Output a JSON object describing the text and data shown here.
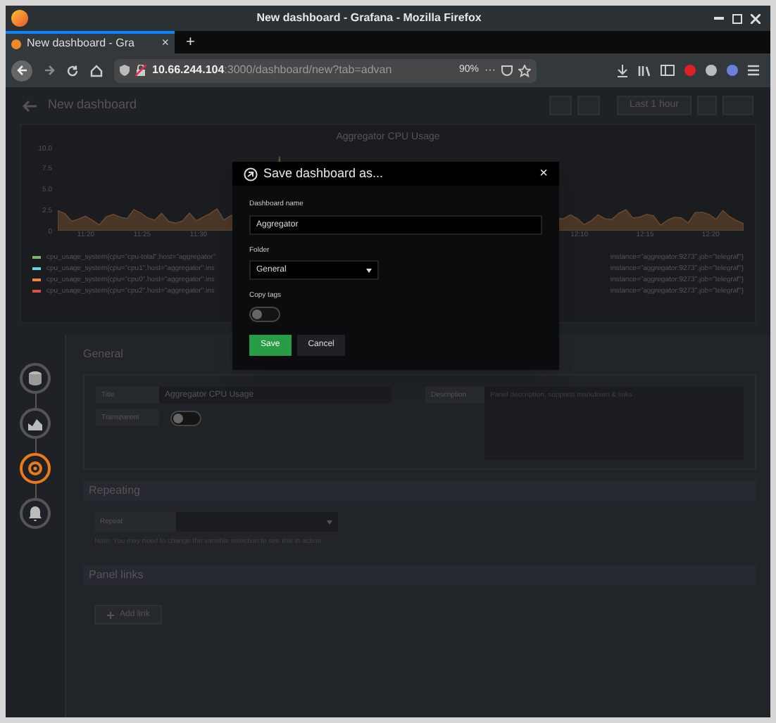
{
  "window": {
    "title": "New dashboard - Grafana - Mozilla Firefox"
  },
  "browser": {
    "tabs": [
      {
        "label": "New dashboard - Gra",
        "selected": true
      }
    ],
    "close_tab": "×",
    "new_tab": "+",
    "url_host": "10.66.244.104",
    "url_path": ":3000/dashboard/new?tab=advan",
    "zoom": "90%",
    "more": "···"
  },
  "dashboard": {
    "title": "New dashboard",
    "time_range": "Last 1 hour"
  },
  "panel": {
    "title": "Aggregator CPU Usage",
    "yticks": [
      "10.0",
      "7.5",
      "5.0",
      "2.5",
      "0"
    ],
    "xticks": [
      "11:20",
      "11:25",
      "11:30",
      "12:10",
      "12:15",
      "12:20"
    ],
    "legend": [
      {
        "left": "cpu_usage_system{cpu=\"cpu-total\",host=\"aggregator\"",
        "right": "instance=\"aggregator:9273\",job=\"telegraf\"}",
        "color": "#7eb26d"
      },
      {
        "left": "cpu_usage_system{cpu=\"cpu1\",host=\"aggregator\",ins",
        "right": "instance=\"aggregator:9273\",job=\"telegraf\"}",
        "color": "#6ed0e0"
      },
      {
        "left": "cpu_usage_system{cpu=\"cpu0\",host=\"aggregator\",ins",
        "right": "instance=\"aggregator:9273\",job=\"telegraf\"}",
        "color": "#ef843c"
      },
      {
        "left": "cpu_usage_system{cpu=\"cpu2\",host=\"aggregator\",ins",
        "right": "instance=\"aggregator:9273\",job=\"telegraf\"}",
        "color": "#e24d42"
      }
    ]
  },
  "dialog": {
    "title": "Save dashboard as...",
    "close": "×",
    "name_label": "Dashboard name",
    "name_value": "Aggregator",
    "folder_label": "Folder",
    "folder_value": "General",
    "copy_tags_label": "Copy tags",
    "copy_tags": false,
    "save": "Save",
    "cancel": "Cancel"
  },
  "editor": {
    "steps": [
      {
        "kind": "queries",
        "selected": false
      },
      {
        "kind": "visualization",
        "selected": false
      },
      {
        "kind": "general",
        "selected": true
      },
      {
        "kind": "alert",
        "selected": false
      }
    ],
    "general": {
      "heading": "General",
      "title_label": "Title",
      "title_value": "Aggregator CPU Usage",
      "transparent_label": "Transparent",
      "transparent": false,
      "description_label": "Description",
      "description_placeholder": "Panel description, supports markdown & links"
    },
    "repeating": {
      "heading": "Repeating",
      "repeat_label": "Repeat",
      "note": "Note: You may need to change the variable selection to see this in action."
    },
    "links": {
      "heading": "Panel links",
      "add": "Add link"
    }
  }
}
